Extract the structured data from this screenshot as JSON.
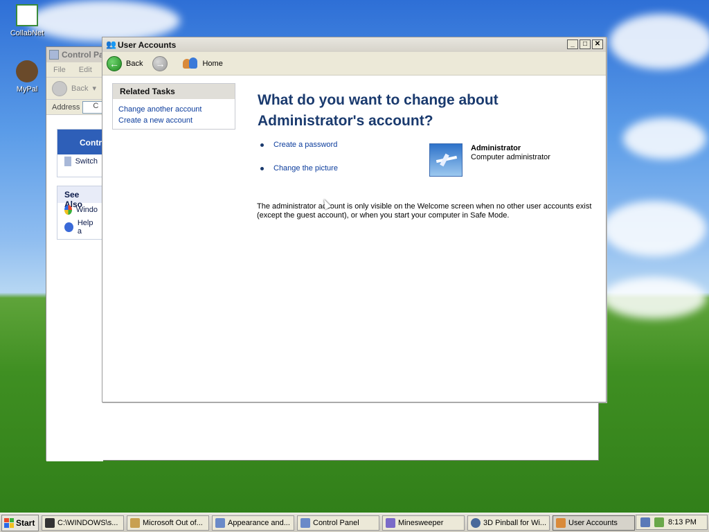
{
  "desktop": {
    "icons": [
      {
        "label": "CollabNet"
      },
      {
        "label": "MyPal"
      }
    ]
  },
  "control_panel": {
    "title": "Control Pa",
    "menu": [
      "File",
      "Edit"
    ],
    "back_label": "Back",
    "address_label": "Address",
    "address_value": "C",
    "panel1_title": "Contr",
    "panel1_item": "Switch",
    "see_also_title": "See Also",
    "see_also_items": [
      "Windo",
      "Help a"
    ]
  },
  "user_accounts": {
    "title": "User Accounts",
    "toolbar": {
      "back": "Back",
      "home": "Home"
    },
    "related_tasks": {
      "title": "Related Tasks",
      "links": [
        "Change another account",
        "Create a new account"
      ]
    },
    "heading": "What do you want to change about Administrator's account?",
    "options": [
      "Create a password",
      "Change the picture"
    ],
    "account": {
      "name": "Administrator",
      "type": "Computer administrator"
    },
    "note": "The administrator account is only visible on the Welcome screen when no other user accounts exist (except the guest account), or when you start your computer in Safe Mode."
  },
  "taskbar": {
    "start_label": "Start",
    "buttons": [
      {
        "label": "C:\\WINDOWS\\s...",
        "color": "#333333"
      },
      {
        "label": "Microsoft Out of...",
        "color": "#c8a050"
      },
      {
        "label": "Appearance and...",
        "color": "#6a8ac8"
      },
      {
        "label": "Control Panel",
        "color": "#6a8ac8"
      },
      {
        "label": "Minesweeper",
        "color": "#7a6ac8"
      },
      {
        "label": "3D Pinball for Wi...",
        "color": "#4a6a9a"
      },
      {
        "label": "User Accounts",
        "color": "#d98a3a"
      }
    ],
    "clock": "8:13 PM"
  }
}
